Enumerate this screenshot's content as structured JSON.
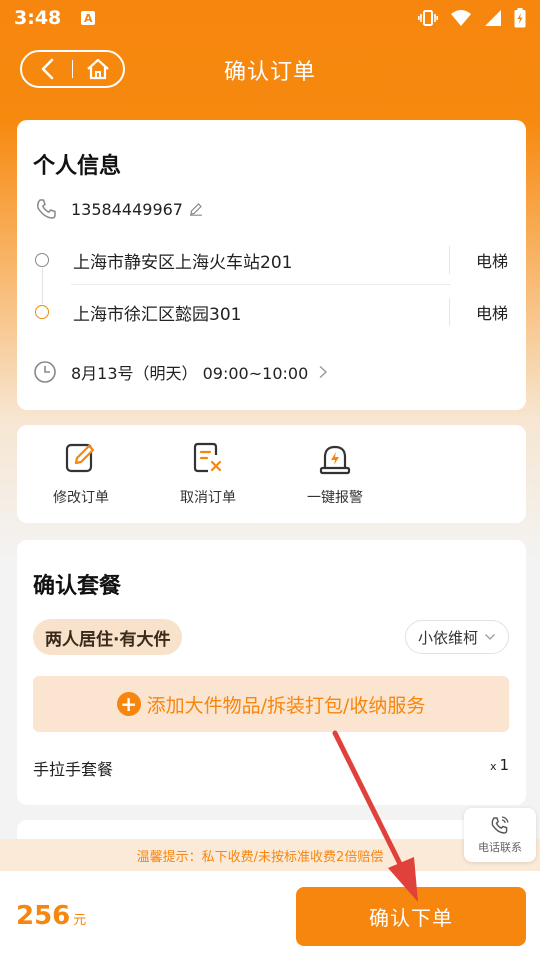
{
  "status_bar": {
    "time": "3:48",
    "notif_letter": "A"
  },
  "nav": {
    "title": "确认订单"
  },
  "personal": {
    "title": "个人信息",
    "phone": "13584449967",
    "from": {
      "address": "上海市静安区上海火车站201",
      "tag": "电梯"
    },
    "to": {
      "address": "上海市徐汇区懿园301",
      "tag": "电梯"
    },
    "time": "8月13号（明天） 09:00~10:00"
  },
  "actions": [
    {
      "label": "修改订单",
      "icon": "edit-order-icon"
    },
    {
      "label": "取消订单",
      "icon": "cancel-order-icon"
    },
    {
      "label": "一键报警",
      "icon": "alarm-icon"
    }
  ],
  "package": {
    "title": "确认套餐",
    "badge": "两人居住·有大件",
    "selected": "小依维柯",
    "add_service": "添加大件物品/拆装打包/收纳服务",
    "item_name": "手拉手套餐",
    "item_qty_prefix": "x",
    "item_qty": "1"
  },
  "tip": "温馨提示：私下收费/未按标准收费2倍赔偿",
  "contact": {
    "label": "电话联系"
  },
  "footer": {
    "price": "256",
    "unit": "元",
    "confirm": "确认下单"
  },
  "colors": {
    "accent": "#f7860e",
    "annotation_arrow": "#e0413a"
  }
}
